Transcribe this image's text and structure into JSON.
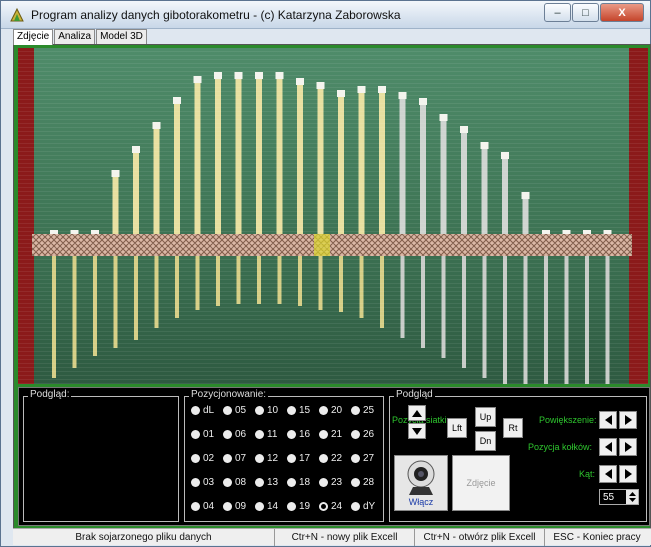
{
  "window": {
    "title": "Program analizy danych gibotorakometru - (c) Katarzyna Zaborowska",
    "controls": {
      "minimize": "–",
      "maximize": "□",
      "close": "X"
    }
  },
  "tabs": [
    {
      "label": "Zdjęcie",
      "active": true
    },
    {
      "label": "Analiza",
      "active": false
    },
    {
      "label": "Model 3D",
      "active": false
    }
  ],
  "preview_group": {
    "title": "Podgląd:"
  },
  "positioning_group": {
    "title": "Pozycjonowanie:",
    "selected": "24",
    "columns": [
      [
        "dL",
        "01",
        "02",
        "03",
        "04"
      ],
      [
        "05",
        "06",
        "07",
        "08",
        "09"
      ],
      [
        "10",
        "11",
        "12",
        "13",
        "14"
      ],
      [
        "15",
        "16",
        "17",
        "18",
        "19"
      ],
      [
        "20",
        "21",
        "22",
        "23",
        "24"
      ],
      [
        "25",
        "26",
        "27",
        "28",
        "dY"
      ]
    ]
  },
  "camera_group": {
    "title": "Podgląd",
    "position_label": "Pozycja siatki:",
    "left_label": "Lft",
    "up_label": "Up",
    "down_label": "Dn",
    "right_label": "Rt",
    "enable_label": "Włącz",
    "photo_label": "Zdjęcie",
    "zoom_label": "Powiększenie:",
    "pins_position_label": "Pozycja kołków:",
    "angle_label": "Kąt:",
    "angle_value": "55"
  },
  "statusbar": {
    "file_status": "Brak sojarzonego pliku danych",
    "new_file_hint": "Ctr+N - nowy plik Excell",
    "open_file_hint": "Ctr+N - otwórz plik Excell",
    "exit_hint": "ESC - Koniec pracy"
  },
  "colors": {
    "background_green": "#2b8a2b",
    "board_green": "#3a6a4c",
    "red_edge": "#8b1a1a",
    "label_green": "#2ec62e"
  }
}
